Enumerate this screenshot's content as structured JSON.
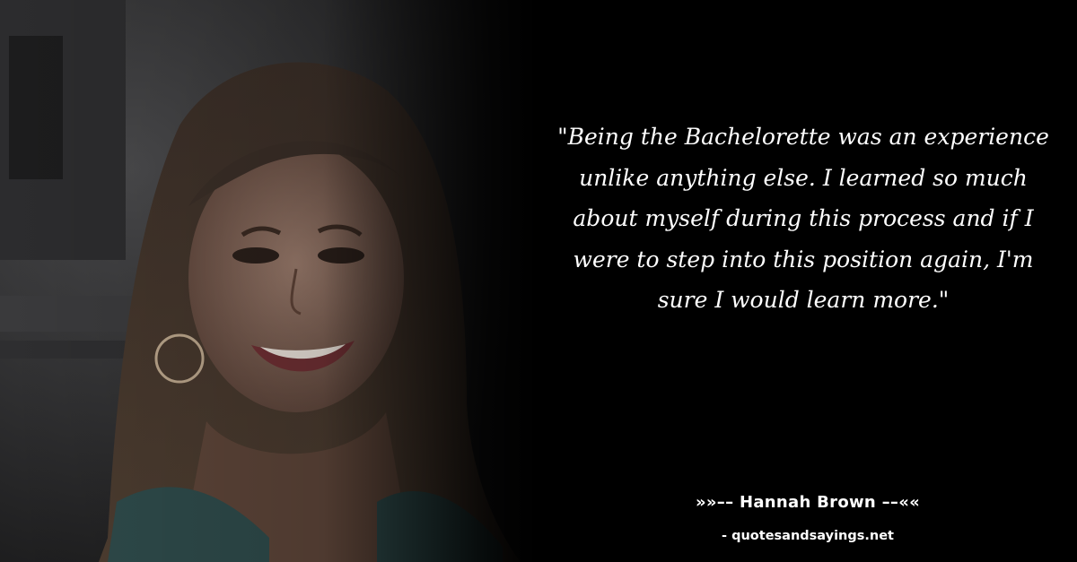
{
  "quote": {
    "text": "\"Being the Bachelorette was an experience unlike anything else. I learned so much about myself during this process and if I were to step into this position again, I'm sure I would learn more.\""
  },
  "attribution": {
    "author": "»»–– Hannah Brown ––««",
    "site": "- quotesandsayings.net"
  },
  "colors": {
    "background": "#000000",
    "text": "#ffffff"
  }
}
